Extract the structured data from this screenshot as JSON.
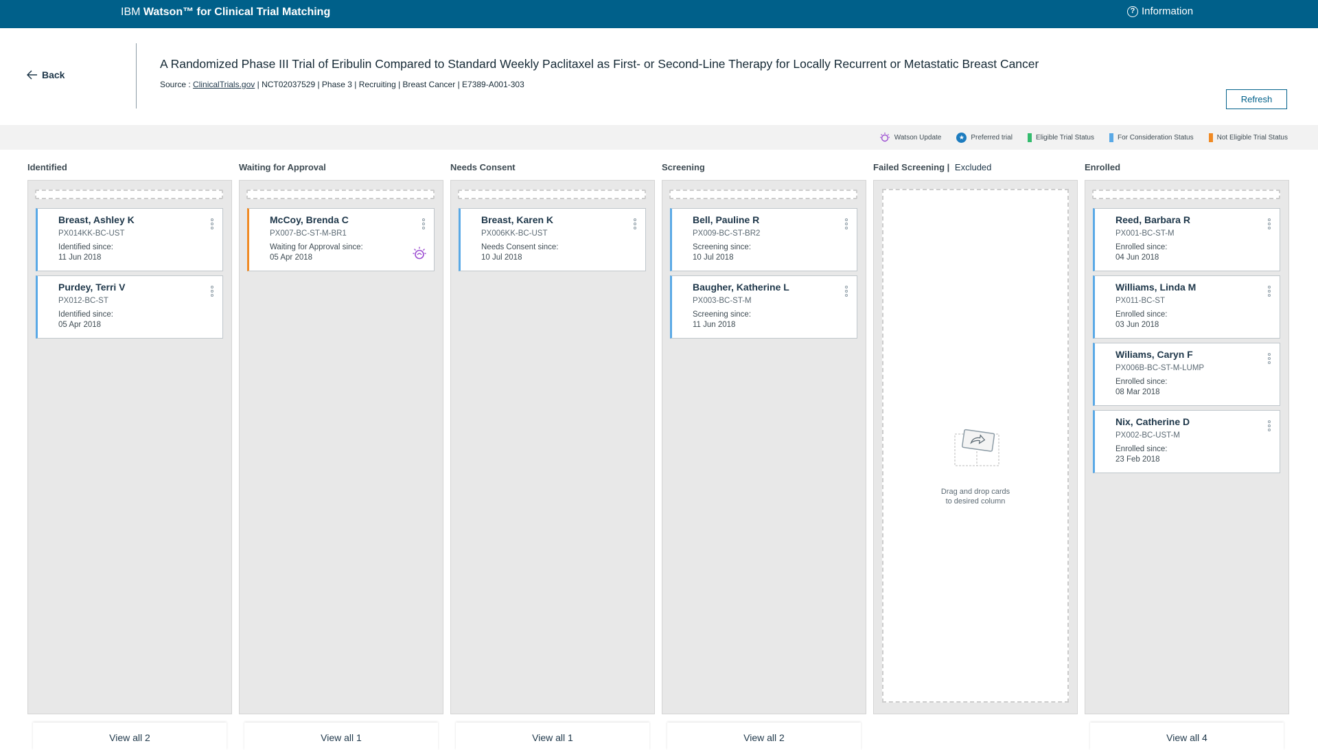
{
  "app": {
    "brand_prefix": "IBM",
    "brand_name": "Watson™ for Clinical Trial Matching",
    "info_label": "Information"
  },
  "header": {
    "back_label": "Back",
    "title": "A Randomized Phase III Trial of Eribulin Compared to Standard Weekly Paclitaxel as First- or Second-Line Therapy for Locally Recurrent or Metastatic Breast Cancer",
    "source_label": "Source : ",
    "source_link": "ClinicalTrials.gov",
    "meta": " | NCT02037529 | Phase 3 | Recruiting | Breast Cancer | E7389-A001-303",
    "refresh_label": "Refresh"
  },
  "legend": {
    "watson_update": "Watson Update",
    "preferred": "Preferred trial",
    "eligible": "Eligible Trial Status",
    "consideration": "For Consideration Status",
    "not_eligible": "Not Eligible Trial Status",
    "colors": {
      "eligible": "#34bc6e",
      "consideration": "#5aa9e6",
      "not_eligible": "#f08a24",
      "watson": "#9b4bd1",
      "preferred": "#1d7cbf"
    }
  },
  "columns": {
    "identified": {
      "title": "Identified",
      "view_all": "View all 2",
      "cards": [
        {
          "name": "Breast, Ashley K",
          "id": "PX014KK-BC-UST",
          "since_label": "Identified since:",
          "since_date": "11 Jun 2018"
        },
        {
          "name": "Purdey, Terri V",
          "id": "PX012-BC-ST",
          "since_label": "Identified since:",
          "since_date": "05 Apr 2018"
        }
      ]
    },
    "waiting": {
      "title": "Waiting for Approval",
      "view_all": "View all 1",
      "cards": [
        {
          "name": "McCoy, Brenda C",
          "id": "PX007-BC-ST-M-BR1",
          "since_label": "Waiting for Approval since:",
          "since_date": "05 Apr 2018"
        }
      ]
    },
    "consent": {
      "title": "Needs Consent",
      "view_all": "View all 1",
      "cards": [
        {
          "name": "Breast, Karen K",
          "id": "PX006KK-BC-UST",
          "since_label": "Needs Consent since:",
          "since_date": "10 Jul 2018"
        }
      ]
    },
    "screening": {
      "title": "Screening",
      "view_all": "View all 2",
      "cards": [
        {
          "name": "Bell, Pauline R",
          "id": "PX009-BC-ST-BR2",
          "since_label": "Screening since:",
          "since_date": "10 Jul 2018"
        },
        {
          "name": "Baugher, Katherine L",
          "id": "PX003-BC-ST-M",
          "since_label": "Screening since:",
          "since_date": "11 Jun 2018"
        }
      ]
    },
    "failed": {
      "title": "Failed Screening |",
      "excluded": "Excluded",
      "drop_line1": "Drag and drop cards",
      "drop_line2": "to desired column"
    },
    "enrolled": {
      "title": "Enrolled",
      "view_all": "View all 4",
      "cards": [
        {
          "name": "Reed, Barbara R",
          "id": "PX001-BC-ST-M",
          "since_label": "Enrolled since:",
          "since_date": "04 Jun 2018"
        },
        {
          "name": "Williams, Linda M",
          "id": "PX011-BC-ST",
          "since_label": "Enrolled since:",
          "since_date": "03 Jun 2018"
        },
        {
          "name": "Wiliams, Caryn F",
          "id": "PX006B-BC-ST-M-LUMP",
          "since_label": "Enrolled since:",
          "since_date": "08 Mar 2018"
        },
        {
          "name": "Nix, Catherine D",
          "id": "PX002-BC-UST-M",
          "since_label": "Enrolled since:",
          "since_date": "23 Feb 2018"
        }
      ]
    }
  }
}
